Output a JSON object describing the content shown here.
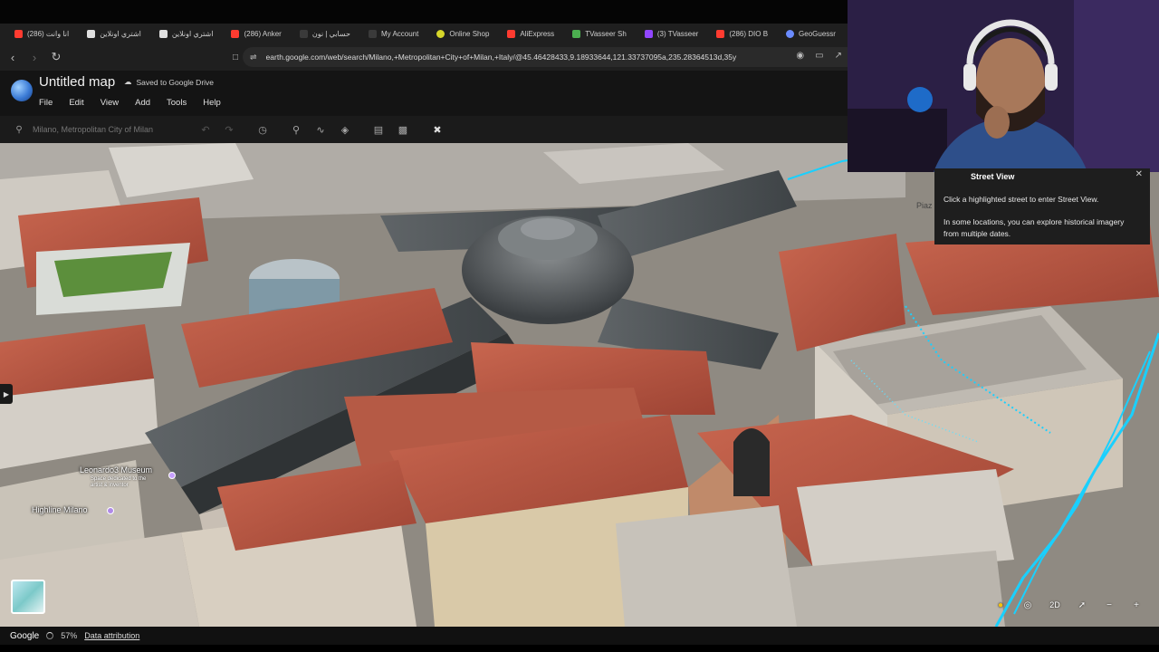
{
  "browser": {
    "tabs": [
      {
        "label": "(286) انا وانت",
        "color": "#ff3b30"
      },
      {
        "label": "اشتري اونلاين",
        "color": "#e0e0e0"
      },
      {
        "label": "اشتري اونلاين",
        "color": "#e0e0e0"
      },
      {
        "label": "(286) Anker",
        "color": "#ff3b30"
      },
      {
        "label": "حسابي | نون",
        "color": "#3a3a3a"
      },
      {
        "label": "My Account",
        "color": "#3a3a3a"
      },
      {
        "label": "Online Shop",
        "color": "#d6d62a"
      },
      {
        "label": "AliExpress",
        "color": "#ff3b30"
      },
      {
        "label": "TVasseer Sh",
        "color": "#4caf50"
      },
      {
        "label": "(3) TVasseer",
        "color": "#9146ff"
      },
      {
        "label": "(286) DIO B",
        "color": "#ff3b30"
      },
      {
        "label": "GeoGuessr",
        "color": "#6a8bff"
      }
    ],
    "url": "earth.google.com/web/search/Milano,+Metropolitan+City+of+Milan,+Italy/@45.46428433,9.18933644,121.33737095a,235.28364513d,35y"
  },
  "earth": {
    "map_title": "Untitled map",
    "saved_status": "Saved to Google Drive",
    "menus": [
      "File",
      "Edit",
      "View",
      "Add",
      "Tools",
      "Help"
    ],
    "search_placeholder": "Milano, Metropolitan City of Milan"
  },
  "map_labels": {
    "museum": "Leonardo3 Museum",
    "museum_sub": "Space dedicated to the artist & inventor",
    "highline": "Highline Milano",
    "piazza": "Piaz"
  },
  "street_view_panel": {
    "title": "Street View",
    "line1": "Click a highlighted street to enter Street View.",
    "line2": "In some locations, you can explore historical imagery from multiple dates."
  },
  "controls": {
    "mode_2d": "2D"
  },
  "status_bar": {
    "google": "Google",
    "loading_percent": "57%",
    "data_attribution": "Data attribution"
  },
  "colors": {
    "street_view_highlight": "#19d0ff",
    "toolbar_bg": "#1b1b1b"
  }
}
